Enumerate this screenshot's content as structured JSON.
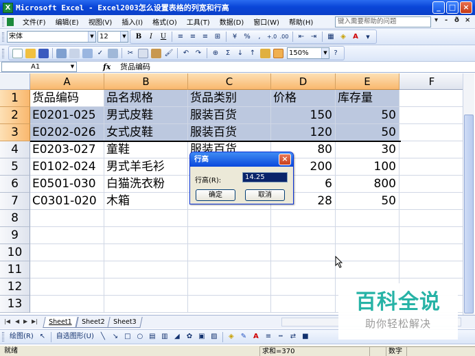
{
  "window": {
    "title": "Microsoft Excel - Excel2003怎么设置表格的列宽和行高",
    "app_icon": "X",
    "controls": [
      "minimize-icon",
      "maximize-icon",
      "close-icon"
    ]
  },
  "menu": {
    "items": [
      "文件(F)",
      "编辑(E)",
      "视图(V)",
      "插入(I)",
      "格式(O)",
      "工具(T)",
      "数据(D)",
      "窗口(W)",
      "帮助(H)"
    ],
    "help_placeholder": "键入需要帮助的问题",
    "right_controls": [
      "▾",
      "- ",
      "ð",
      "×"
    ]
  },
  "format_toolbar": {
    "font": "宋体",
    "size": "12",
    "bold": "B",
    "italic": "I",
    "underline": "U",
    "percent": "%",
    "comma": ",",
    "inc_decimal": "+.0",
    "dec_decimal": ".00",
    "font_color_label": "A"
  },
  "standard_toolbar": {
    "sum": "Σ",
    "zoom": "150%"
  },
  "formula_bar": {
    "name_box": "A1",
    "fx": "fx",
    "value": "货品编码"
  },
  "grid": {
    "columns": [
      "A",
      "B",
      "C",
      "D",
      "E",
      "F"
    ],
    "rows": [
      "1",
      "2",
      "3",
      "4",
      "5",
      "6",
      "7",
      "8",
      "9",
      "10",
      "11",
      "12",
      "13"
    ],
    "data": [
      [
        "货品编码",
        "品名规格",
        "货品类别",
        "价格",
        "库存量"
      ],
      [
        "E0201-025",
        "男式皮鞋",
        "服装百货",
        "150",
        "50"
      ],
      [
        "E0202-026",
        "女式皮鞋",
        "服装百货",
        "120",
        "50"
      ],
      [
        "E0203-027",
        "童鞋",
        "服装百货",
        "80",
        "30"
      ],
      [
        "E0102-024",
        "男式羊毛衫",
        "",
        "200",
        "100"
      ],
      [
        "E0501-030",
        "白猫洗衣粉",
        "",
        "6",
        "800"
      ],
      [
        "C0301-020",
        "木箱",
        "",
        "28",
        "50"
      ]
    ]
  },
  "dialog": {
    "title": "行高",
    "label": "行高(R):",
    "value": "14.25",
    "ok": "确定",
    "cancel": "取消",
    "close": "×"
  },
  "sheet_tabs": {
    "nav": [
      "|◀",
      "◀",
      "▶",
      "▶|"
    ],
    "tabs": [
      "Sheet1",
      "Sheet2",
      "Sheet3"
    ],
    "active": "Sheet1"
  },
  "draw_toolbar": {
    "draw": "绘图(R)",
    "autoshape": "自选图形(U)"
  },
  "status": {
    "ready": "就绪",
    "sum": "求和=370",
    "num": "数字"
  },
  "watermark": {
    "line1": "百科全说",
    "line2": "助你轻松解决"
  }
}
